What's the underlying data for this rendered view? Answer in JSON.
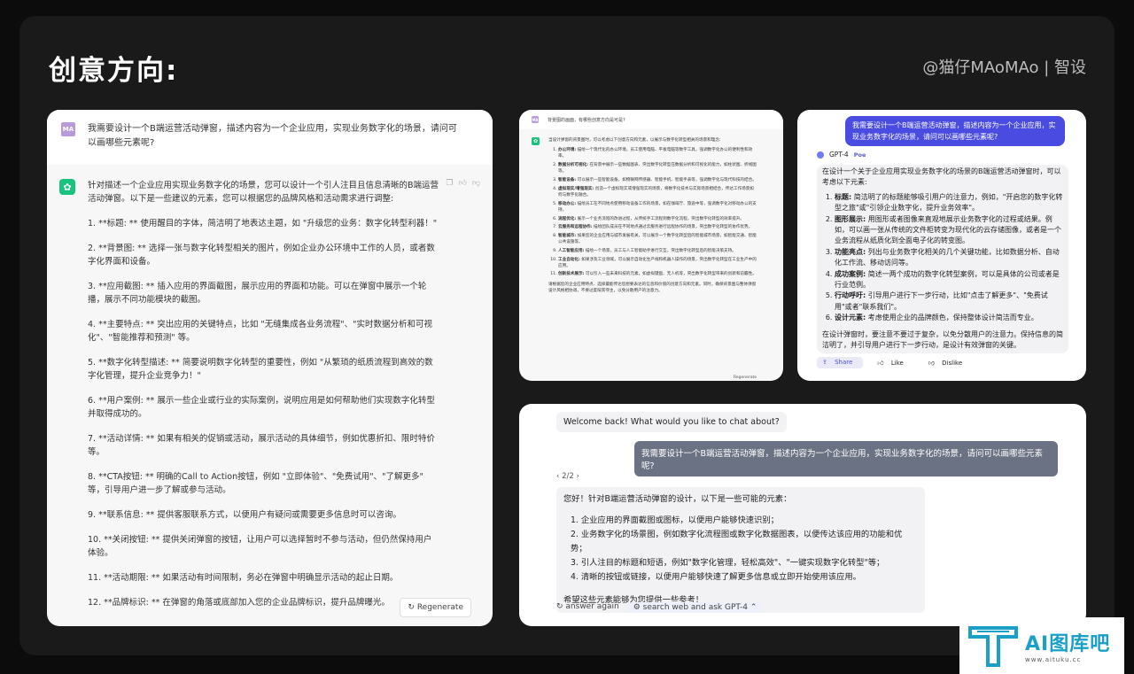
{
  "header": {
    "title": "创意方向:",
    "credit": "@猫仔MAoMAo | 智设"
  },
  "card1": {
    "user_avatar": "MA",
    "question": "我需要设计一个B端运营活动弹窗，描述内容为一个企业应用，实现业务数字化的场景，请问可以画哪些元素呢?",
    "paragraphs": [
      "针对描述一个企业应用实现业务数字化的场景，您可以设计一个引人注目且信息清晰的B端运营活动弹窗。以下是一些建议的元素，您可以根据您的品牌风格和活动需求进行调整:",
      "1. **标题: ** 使用醒目的字体，简洁明了地表达主题，如 \"升级您的业务：数字化转型利器！\"",
      "2. **背景图: ** 选择一张与数字化转型相关的图片，例如企业办公环境中工作的人员，或者数字化界面和设备。",
      "3. **应用截图: ** 插入应用的界面截图，展示应用的界面和功能。可以在弹窗中展示一个轮播，展示不同功能模块的截图。",
      "4. **主要特点: ** 突出应用的关键特点，比如 \"无缝集成各业务流程\"、\"实时数据分析和可视化\"、\"智能推荐和预测\" 等。",
      "5. **数字化转型描述: ** 简要说明数字化转型的重要性，例如 \"从繁琐的纸质流程到高效的数字化管理，提升企业竞争力！\"",
      "6. **用户案例: ** 展示一些企业或行业的实际案例，说明应用是如何帮助他们实现数字化转型并取得成功的。",
      "7. **活动详情: ** 如果有相关的促销或活动，展示活动的具体细节，例如优惠折扣、限时特价等。",
      "8. **CTA按钮: ** 明确的Call to Action按钮，例如 \"立即体验\"、\"免费试用\"、\"了解更多\" 等，引导用户进一步了解或参与活动。",
      "9. **联系信息: ** 提供客服联系方式，以便用户有疑问或需要更多信息时可以咨询。",
      "10. **关闭按钮: ** 提供关闭弹窗的按钮，让用户可以选择暂时不参与活动，但仍然保持用户体验。",
      "11. **活动期限: ** 如果活动有时间限制，务必在弹窗中明确显示活动的起止日期。",
      "12. **品牌标识: ** 在弹窗的角落或底部加入您的企业品牌标识，提升品牌曝光。"
    ],
    "regenerate_label": "Regenerate"
  },
  "card2": {
    "question": "背景图的画面，有哪些创意方向是可是?",
    "intro": "当设计弹窗的背景图时，可以考虑以下创意方向和元素，以展示与数字化转型相关的场景和理念:",
    "items": [
      {
        "k": "办公环境:",
        "v": "描绘一个现代化的办公环境，员工使用电脑、平板电脑等数字工具，强调数字化办公的便利性和效率。"
      },
      {
        "k": "数据分析可视化:",
        "v": "在背景中展示一些数据图表、突出数字化转型在数据分析和可视化的能力，如柱状图、折线图等。"
      },
      {
        "k": "智能设备:",
        "v": "可以展示一些智能设备，如物联网传感器、智能手机、智能手表等，强调数字化与现代科技的结合。"
      },
      {
        "k": "虚拟现实/增强现实:",
        "v": "创造一个虚拟现实或增强现实的场景，将数字化技术与实际场景相结合，传达工作场景如何与数字化融合。"
      },
      {
        "k": "移动办公:",
        "v": "描绘员工在不同地点使用移动设备工作的场景，如在咖啡厅、旅途中等，强调数字化对移动办公的支持。"
      },
      {
        "k": "流程优化:",
        "v": "展示一个业务流程的改进过程，从传统手工流程到数字化流程，突出数字化转型的效率提升。"
      },
      {
        "k": "云服务和远程协作:",
        "v": "描绘团队成员在不同地点通过云服务进行远程协作的场景，突出数字化转型的协作优势。"
      },
      {
        "k": "智能城市:",
        "v": "如果您的企业应用与城市发展有关，可以展示一个数字化转型后的智能城市场景，如智能交通、智能公共设施等。"
      },
      {
        "k": "人工智能应用:",
        "v": "描绘一个场景，员工与人工智能助手进行交互，突出数字化转型后的智能决策支持。"
      },
      {
        "k": "工业自动化:",
        "v": "如果涉及工业领域，可以展示自动化生产线和机器人操作的场景，突出数字化转型在工业生产中的应用。"
      },
      {
        "k": "创新技术展示:",
        "v": "可以引入一些未来科技的元素，如虚拟键盘、无人机等，突出数字化转型带来的创新和前瞻性。"
      }
    ],
    "outro": "请根据您的企业应用特点、选择最能传达您想要表达的信息和价值的创意方向和元素。同时，确保背景图与整体弹窗设计风格相协调，不要过度喧宾夺主，以免分散用户的注意力。",
    "footer": "Regenerate"
  },
  "card3": {
    "question": "我需要设计一个B端运营活动弹窗，描述内容为一个企业应用，实现业务数字化的场景，请问可以画哪些元素呢?",
    "bot_name": "GPT-4",
    "platform": "Poe",
    "intro": "在设计一个关于企业应用实现业务数字化的场景的B端运营活动弹窗时，可以考虑以下元素:",
    "items": [
      {
        "k": "标题:",
        "v": "简洁明了的标题能够吸引用户的注意力，例如，\"开启您的数字化转型之旅\"或\"引领企业数字化，提升业务效率\"。"
      },
      {
        "k": "图形展示:",
        "v": "用图形或者图像来直观地展示业务数字化的过程或结果。例如，可以画一张从传统的文件柜转变为现代化的云存储图像，或者是一个业务流程从纸质化到全面电子化的转变图。"
      },
      {
        "k": "功能亮点:",
        "v": "列出与业务数字化相关的几个关键功能，比如数据分析、自动化工作流、移动访问等。"
      },
      {
        "k": "成功案例:",
        "v": "简述一两个成功的数字化转型案例，可以是具体的公司或者是行业范例。"
      },
      {
        "k": "行动呼吁:",
        "v": "引导用户进行下一步行动，比如\"点击了解更多\"、\"免费试用\"或者\"联系我们\"。"
      },
      {
        "k": "设计元素:",
        "v": "考虑使用企业的品牌颜色，保持整体设计简洁而专业。"
      }
    ],
    "outro": "在设计弹窗时，要注意不要过于复杂，以免分散用户的注意力。保持信息的简洁明了，并引导用户进行下一步行动，是设计有效弹窗的关键。",
    "actions": {
      "share": "Share",
      "like": "Like",
      "dislike": "Dislike"
    }
  },
  "card4": {
    "welcome": "Welcome back! What would you like to chat about?",
    "question": "我需要设计一个B端运营活动弹窗，描述内容为一个企业应用，实现业务数字化的场景，请问可以画哪些元素呢?",
    "pager": "2/2",
    "intro": "您好！针对B端运营活动弹窗的设计，以下是一些可能的元素：",
    "items": [
      "1. 企业应用的界面截图或图标，以便用户能够快速识别；",
      "2. 业务数字化的场景图，例如数字化流程图或数字化数据图表，以便传达该应用的功能和优势；",
      "3. 引人注目的标题和短语，例如\"数字化管理，轻松高效\"、\"一键实现数字化转型\"等；",
      "4. 清晰的按钮或链接，以便用户能够快速了解更多信息或立即开始使用该应用。"
    ],
    "outro": "希望这些元素能够为您提供一些参考！",
    "answer_again": "answer again",
    "search_web": "search web and ask GPT-4"
  },
  "watermark": {
    "name": "AI图库吧",
    "url": "www.aituku.cc",
    "brand_color": "#1aa0c8"
  }
}
